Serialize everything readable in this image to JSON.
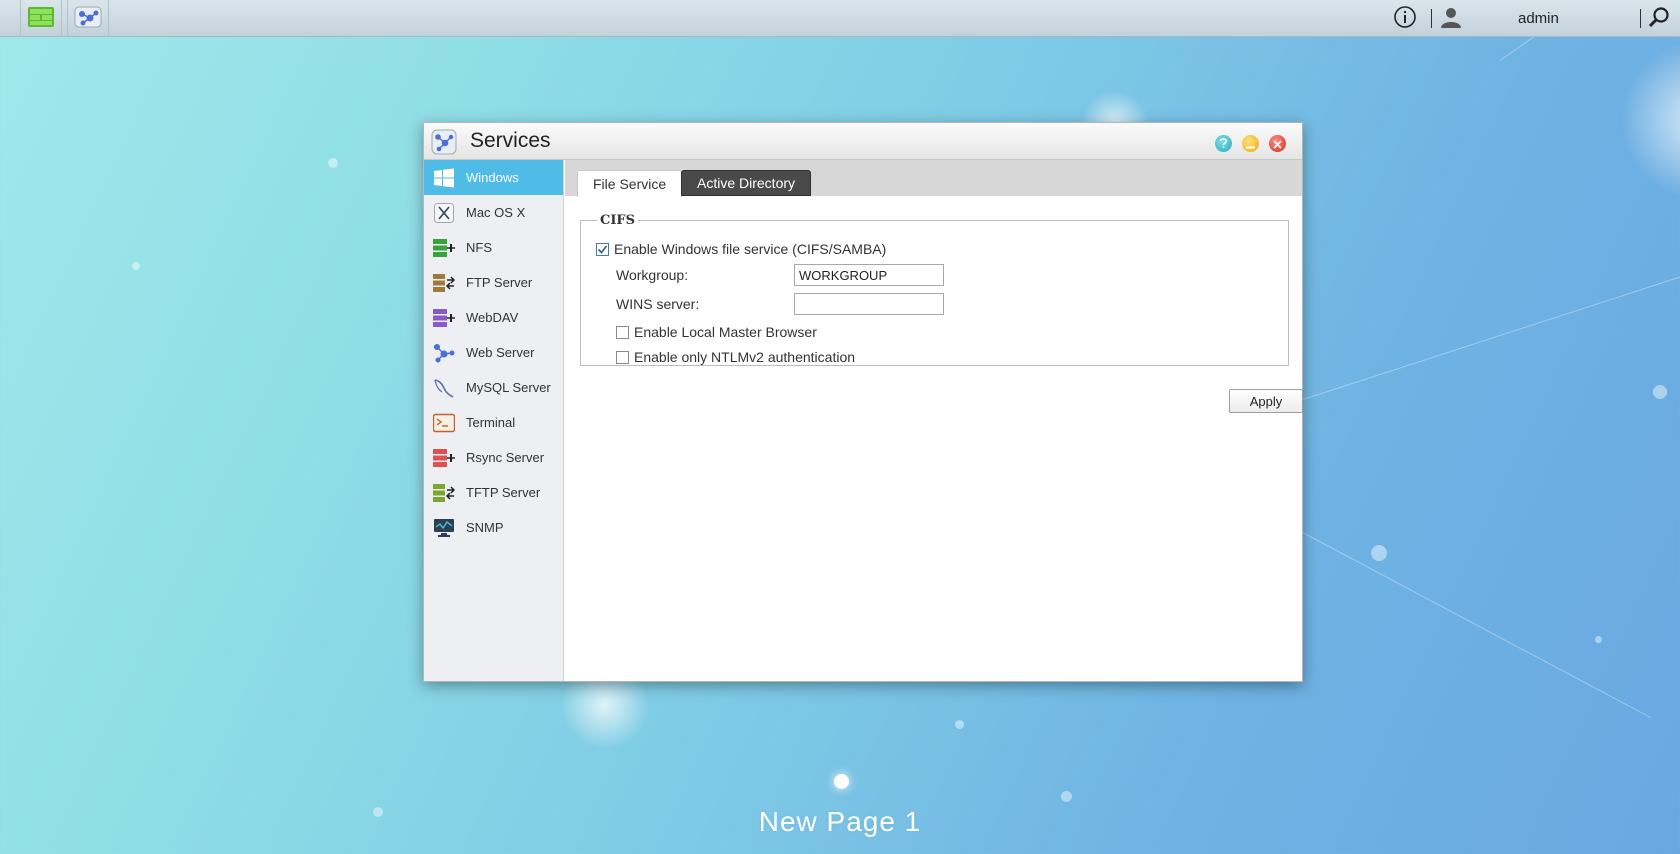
{
  "topbar": {
    "apps": [
      {
        "name": "storage-app-icon"
      },
      {
        "name": "services-app-icon"
      }
    ],
    "info_icon": "info-icon",
    "user_icon": "user-icon",
    "username": "admin",
    "search_icon": "search-icon"
  },
  "window": {
    "title": "Services",
    "controls": [
      "help-icon",
      "minimize-icon",
      "close-icon"
    ]
  },
  "sidebar": {
    "items": [
      {
        "label": "Windows",
        "icon": "windows-icon",
        "active": true
      },
      {
        "label": "Mac OS X",
        "icon": "macosx-icon",
        "active": false
      },
      {
        "label": "NFS",
        "icon": "nfs-icon",
        "active": false
      },
      {
        "label": "FTP Server",
        "icon": "ftp-server-icon",
        "active": false
      },
      {
        "label": "WebDAV",
        "icon": "webdav-icon",
        "active": false
      },
      {
        "label": "Web Server",
        "icon": "web-server-icon",
        "active": false
      },
      {
        "label": "MySQL Server",
        "icon": "mysql-server-icon",
        "active": false
      },
      {
        "label": "Terminal",
        "icon": "terminal-icon",
        "active": false
      },
      {
        "label": "Rsync Server",
        "icon": "rsync-server-icon",
        "active": false
      },
      {
        "label": "TFTP Server",
        "icon": "tftp-server-icon",
        "active": false
      },
      {
        "label": "SNMP",
        "icon": "snmp-icon",
        "active": false
      }
    ]
  },
  "tabs": {
    "file_service": "File Service",
    "active_directory": "Active Directory",
    "selected": "File Service"
  },
  "cifs": {
    "legend": "CIFS",
    "enable_service": {
      "label": "Enable Windows file service (CIFS/SAMBA)",
      "checked": true
    },
    "workgroup": {
      "label": "Workgroup:",
      "value": "WORKGROUP"
    },
    "wins_server": {
      "label": "WINS server:",
      "value": ""
    },
    "local_master_browser": {
      "label": "Enable Local Master Browser",
      "checked": false
    },
    "ntlmv2_only": {
      "label": "Enable only NTLMv2 authentication",
      "checked": false
    }
  },
  "apply_label": "Apply",
  "desktop": {
    "page_label": "New Page 1"
  },
  "colors": {
    "accent": "#4fbce8",
    "tab_inactive": "#4a4a4a"
  }
}
